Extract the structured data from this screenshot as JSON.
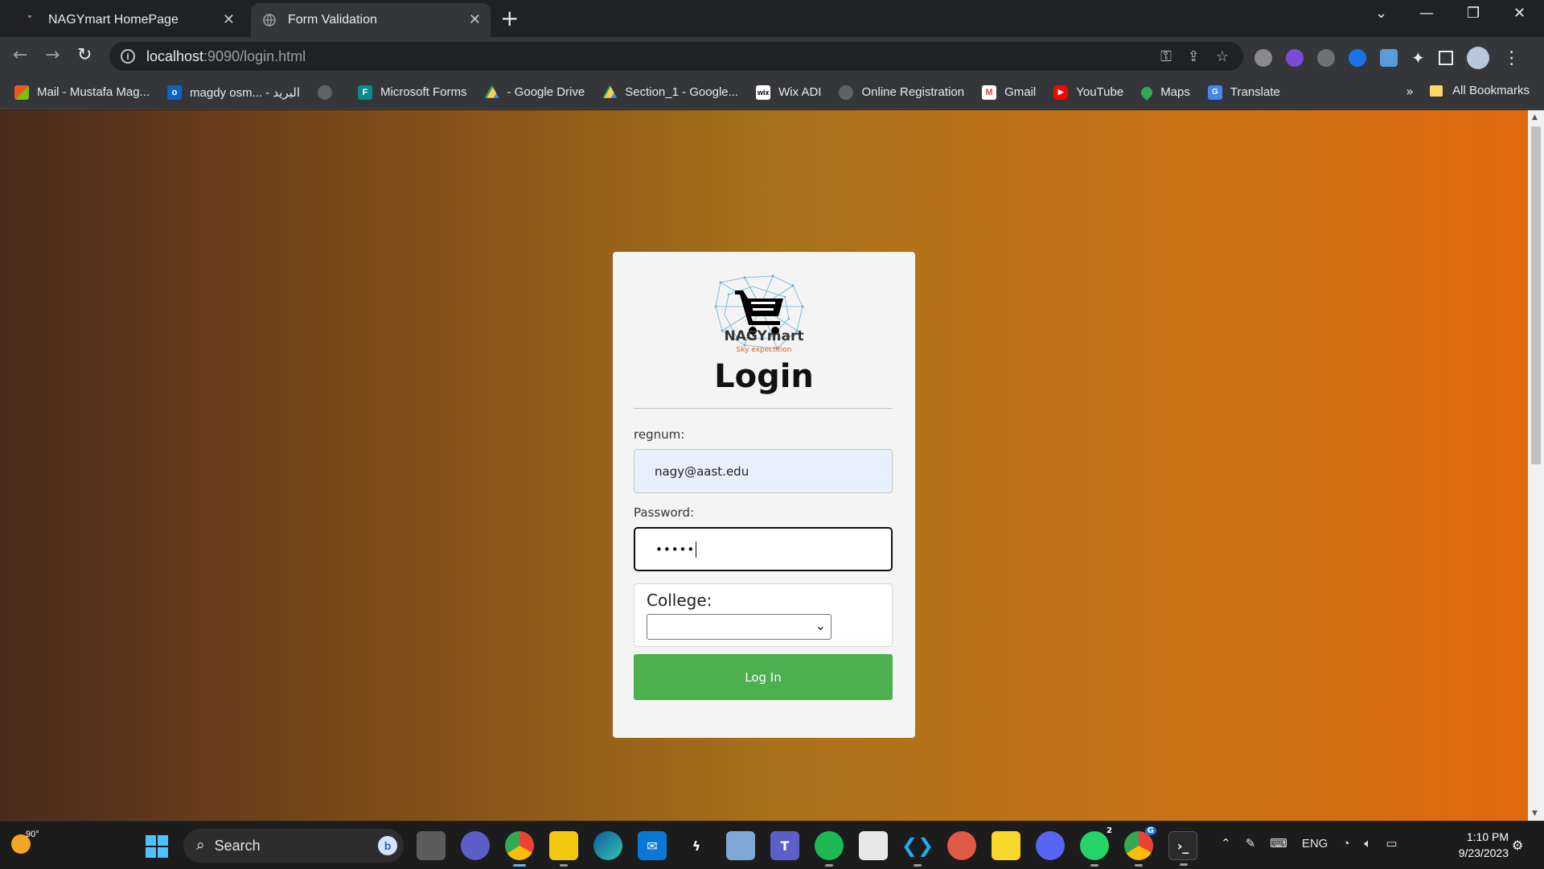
{
  "browser": {
    "tabs": [
      {
        "title": "NAGYmart HomePage",
        "active": false
      },
      {
        "title": "Form Validation",
        "active": true
      }
    ],
    "url_host": "localhost",
    "url_rest": ":9090/login.html",
    "bookmarks": [
      {
        "label": "Mail - Mustafa Mag...",
        "icon": "microsoft-icon",
        "color": "#f35325"
      },
      {
        "label": "magdy osm... - البريد",
        "icon": "outlook-icon",
        "color": "#0a64c8"
      },
      {
        "label": "",
        "icon": "globe-icon",
        "color": "#5f6368"
      },
      {
        "label": "Microsoft Forms",
        "icon": "forms-icon",
        "color": "#058c89"
      },
      {
        "label": "- Google Drive",
        "icon": "drive-icon",
        "color": "#1fa463"
      },
      {
        "label": "Section_1 - Google...",
        "icon": "drive-icon",
        "color": "#1fa463"
      },
      {
        "label": "Wix ADI",
        "icon": "wix-icon",
        "color": "#000000"
      },
      {
        "label": "Online Registration",
        "icon": "globe-icon",
        "color": "#5f6368"
      },
      {
        "label": "Gmail",
        "icon": "gmail-icon",
        "color": "#ea4335"
      },
      {
        "label": "YouTube",
        "icon": "youtube-icon",
        "color": "#ff0000"
      },
      {
        "label": "Maps",
        "icon": "maps-icon",
        "color": "#34a853"
      },
      {
        "label": "Translate",
        "icon": "translate-icon",
        "color": "#4285f4"
      }
    ],
    "all_bookmarks": "All Bookmarks",
    "more": "»"
  },
  "page": {
    "brand": "NAGYmart",
    "tagline": "Sky expectition",
    "heading": "Login",
    "regnum_label": "regnum:",
    "regnum_value": "nagy@aast.edu",
    "password_label": "Password:",
    "password_value": "•••••",
    "college_label": "College:",
    "college_value": "",
    "login_button": "Log In",
    "button_color": "#4caf50"
  },
  "taskbar": {
    "weather_temp": "90°",
    "search_placeholder": "Search",
    "tray_lang": "ENG",
    "time": "1:10 PM",
    "date": "9/23/2023",
    "whatsapp_badge": "2",
    "chrome_badge": "G"
  }
}
